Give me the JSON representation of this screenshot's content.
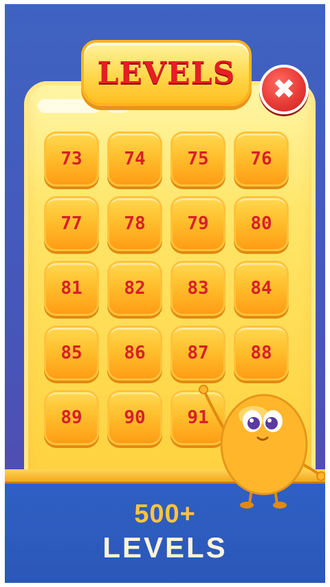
{
  "header": {
    "title": "LEVELS"
  },
  "close_button": {
    "icon": "close-icon",
    "glyph": "✖",
    "color": "#e83b37"
  },
  "levels": [
    "73",
    "74",
    "75",
    "76",
    "77",
    "78",
    "79",
    "80",
    "81",
    "82",
    "83",
    "84",
    "85",
    "86",
    "87",
    "88",
    "89",
    "90",
    "91"
  ],
  "promo": {
    "count": "500+",
    "word": "LEVELS"
  },
  "colors": {
    "background": "#4656b9",
    "panel": "#ffd94d",
    "tile": "#ffbf2d",
    "number": "#d7202a",
    "title": "#e41f24",
    "promo_count": "#ffc53a",
    "promo_word": "#fff4da"
  }
}
